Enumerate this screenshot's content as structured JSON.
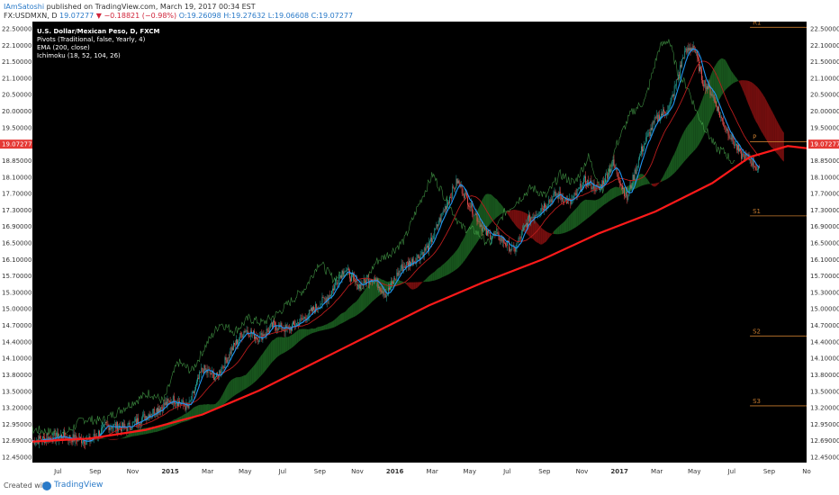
{
  "header": {
    "author": "IAmSatoshi",
    "published": "published on TradingView.com, March 19, 2017 00:34 EST",
    "symbol": "FX:USDMXN, D",
    "last": "19.07277",
    "change": "−0.18821 (−0.98%)",
    "open": "O:19.26098",
    "high": "H:19.27632",
    "low": "L:19.06608",
    "close": "C:19.07277"
  },
  "legend": {
    "title": "U.S. Dollar/Mexican Peso, D, FXCM",
    "items": [
      "Pivots (Traditional, false, Yearly, 4)",
      "EMA (200, close)",
      "Ichimoku (18, 52, 104, 26)"
    ]
  },
  "footer": {
    "created": "Created with",
    "brand": "TradingView"
  },
  "colors": {
    "background": "#000000",
    "candle_up": "#26a69a",
    "candle_down": "#ef5350",
    "ema": "#ff1a1a",
    "conversion": "#2196f3",
    "base": "#b71c1c",
    "lagging": "#4caf50",
    "cloud_bull": "#1b5e20",
    "cloud_bear": "#7f1010",
    "pivot": "#c67a2e",
    "price_label": "#e53935"
  },
  "chart_data": {
    "type": "candlestick",
    "symbol": "FX:USDMXN",
    "timeframe": "D",
    "x_ticks": [
      "Jul",
      "Sep",
      "Nov",
      "2015",
      "Mar",
      "May",
      "Jul",
      "Sep",
      "Nov",
      "2016",
      "Mar",
      "May",
      "Jul",
      "Sep",
      "Nov",
      "2017",
      "Mar",
      "May",
      "Jul",
      "Sep",
      "No"
    ],
    "y_ticks": [
      "22.50000",
      "22.10000",
      "21.50000",
      "21.10000",
      "20.50000",
      "20.00000",
      "19.50000",
      "19.07277",
      "18.85000",
      "18.10000",
      "17.70000",
      "17.30000",
      "16.90000",
      "16.50000",
      "16.10000",
      "15.70000",
      "15.30000",
      "15.00000",
      "14.70000",
      "14.40000",
      "14.10000",
      "13.80000",
      "13.50000",
      "13.20000",
      "12.95000",
      "12.69000",
      "12.45000"
    ],
    "ylim": [
      12.45,
      22.55
    ],
    "last_price": 19.07277,
    "ema_200": [
      [
        0,
        12.93
      ],
      [
        60,
        13.0
      ],
      [
        120,
        13.2
      ],
      [
        180,
        13.55
      ],
      [
        240,
        14.1
      ],
      [
        300,
        14.75
      ],
      [
        360,
        15.4
      ],
      [
        420,
        16.05
      ],
      [
        480,
        16.6
      ],
      [
        540,
        17.1
      ],
      [
        600,
        17.7
      ],
      [
        660,
        18.2
      ],
      [
        720,
        18.85
      ],
      [
        760,
        19.45
      ],
      [
        800,
        19.7
      ],
      [
        820,
        19.65
      ]
    ],
    "price_path": [
      [
        0,
        12.95
      ],
      [
        30,
        13.05
      ],
      [
        60,
        12.95
      ],
      [
        80,
        13.3
      ],
      [
        100,
        13.25
      ],
      [
        130,
        13.65
      ],
      [
        150,
        13.9
      ],
      [
        165,
        13.7
      ],
      [
        180,
        14.6
      ],
      [
        195,
        14.4
      ],
      [
        210,
        15.0
      ],
      [
        225,
        15.5
      ],
      [
        240,
        15.3
      ],
      [
        255,
        15.6
      ],
      [
        270,
        15.5
      ],
      [
        285,
        15.7
      ],
      [
        300,
        16.0
      ],
      [
        315,
        16.3
      ],
      [
        330,
        16.9
      ],
      [
        345,
        16.5
      ],
      [
        360,
        16.7
      ],
      [
        375,
        16.3
      ],
      [
        390,
        16.9
      ],
      [
        405,
        17.1
      ],
      [
        420,
        17.4
      ],
      [
        435,
        18.2
      ],
      [
        450,
        18.9
      ],
      [
        465,
        18.3
      ],
      [
        480,
        17.7
      ],
      [
        495,
        17.6
      ],
      [
        510,
        17.3
      ],
      [
        525,
        18.0
      ],
      [
        540,
        18.3
      ],
      [
        555,
        18.6
      ],
      [
        570,
        18.4
      ],
      [
        585,
        18.9
      ],
      [
        600,
        18.7
      ],
      [
        615,
        19.3
      ],
      [
        630,
        18.5
      ],
      [
        645,
        19.6
      ],
      [
        660,
        20.3
      ],
      [
        675,
        20.6
      ],
      [
        690,
        21.8
      ],
      [
        700,
        22.0
      ],
      [
        710,
        21.2
      ],
      [
        720,
        20.9
      ],
      [
        730,
        20.3
      ],
      [
        740,
        19.9
      ],
      [
        750,
        19.5
      ],
      [
        760,
        19.4
      ],
      [
        770,
        19.1
      ]
    ],
    "pivots": [
      {
        "label": "R1",
        "value": 22.42
      },
      {
        "label": "P",
        "value": 19.8
      },
      {
        "label": "S1",
        "value": 18.1
      },
      {
        "label": "S2",
        "value": 15.35
      },
      {
        "label": "S3",
        "value": 13.75
      }
    ]
  }
}
